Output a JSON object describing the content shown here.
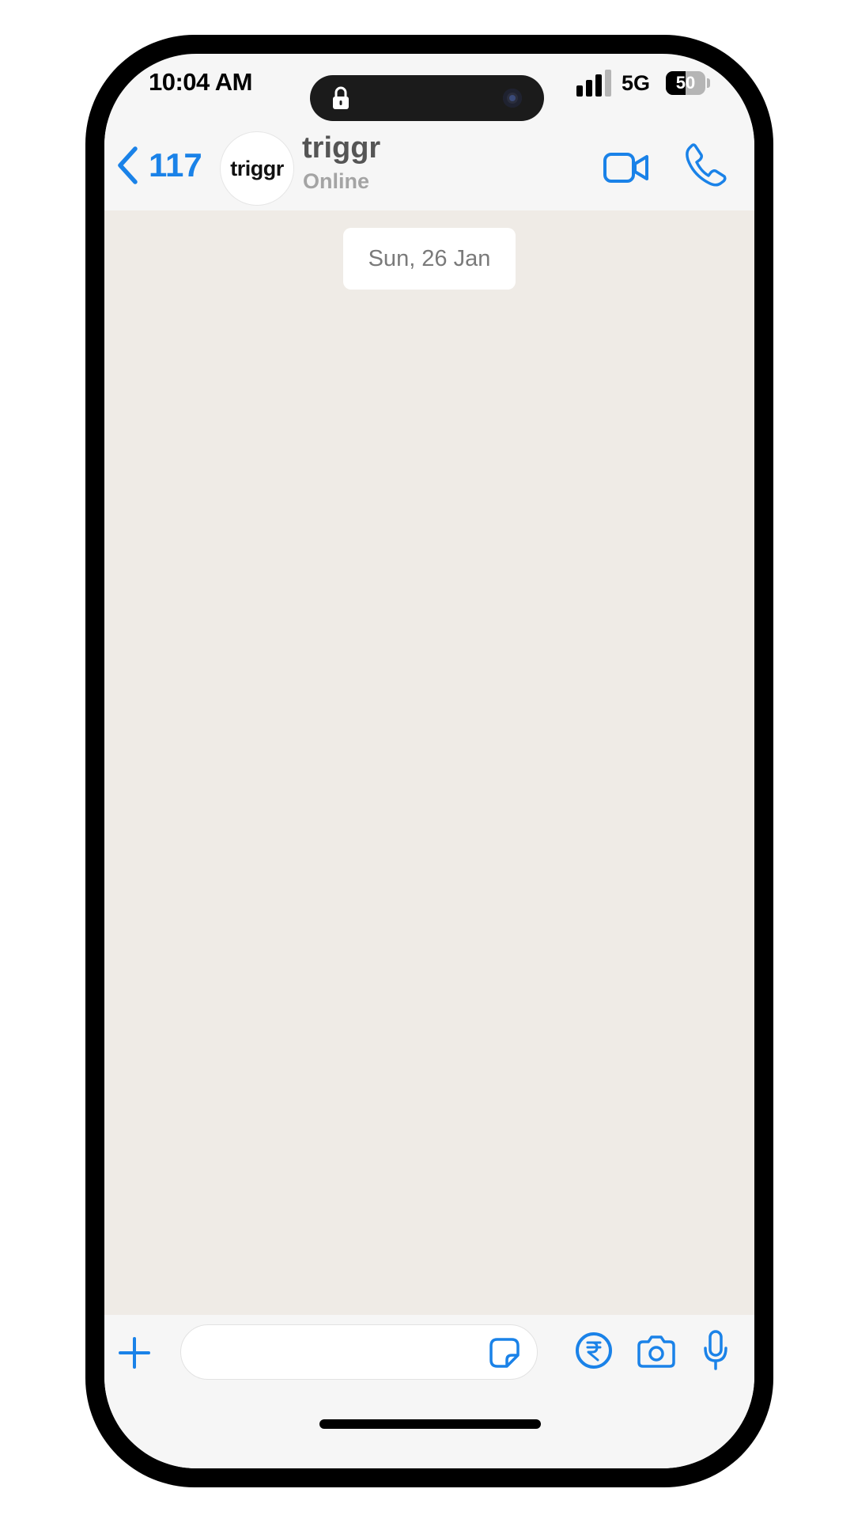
{
  "status_bar": {
    "time": "10:04 AM",
    "network": "5G",
    "battery_percent": "50",
    "battery_level": 0.5
  },
  "header": {
    "back_count": "117",
    "avatar_logo_text": "triggr",
    "contact_name": "triggr",
    "contact_status": "Online",
    "icons": {
      "back": "chevron-left-icon",
      "video": "video-camera-icon",
      "call": "phone-icon"
    }
  },
  "chat": {
    "date_separator": "Sun, 26 Jan"
  },
  "input_bar": {
    "message_value": "",
    "message_placeholder": "",
    "icons": {
      "plus": "plus-icon",
      "sticker": "sticker-icon",
      "payment": "rupee-icon",
      "camera": "camera-icon",
      "mic": "microphone-icon"
    }
  },
  "colors": {
    "accent": "#1a82e8",
    "chat_background": "#efebe6",
    "bar_background": "#f6f6f6",
    "logo_dot": "#2ebd59"
  }
}
